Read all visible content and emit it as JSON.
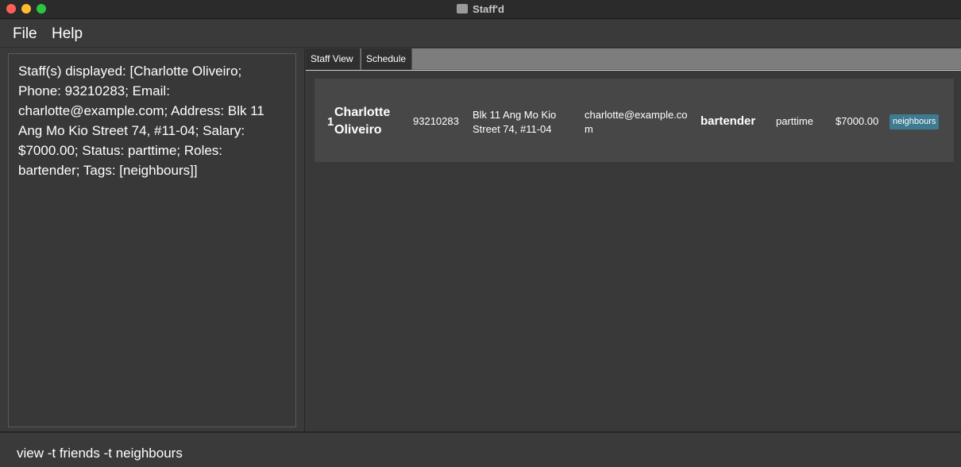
{
  "window": {
    "title": "Staff'd",
    "controls": [
      "close",
      "minimize",
      "maximize"
    ]
  },
  "menu": {
    "file": "File",
    "help": "Help"
  },
  "result_display": {
    "text": "Staff(s) displayed: [Charlotte Oliveiro; Phone: 93210283; Email: charlotte@example.com; Address: Blk 11 Ang Mo Kio Street 74, #11-04; Salary: $7000.00; Status: parttime; Roles: bartender; Tags: [neighbours]]"
  },
  "tabs": {
    "staff_view": "Staff View",
    "schedule": "Schedule"
  },
  "staff_list": [
    {
      "index": "1",
      "name": "Charlotte Oliveiro",
      "phone": "93210283",
      "address": "Blk 11 Ang Mo Kio Street 74, #11-04",
      "email": "charlotte@example.com",
      "role": "bartender",
      "status": "parttime",
      "salary": "$7000.00",
      "tag": "neighbours"
    }
  ],
  "command_box": {
    "value": "view -t friends -t neighbours"
  },
  "colors": {
    "tag": "#3e7b91",
    "background": "#3a3a3a",
    "card": "#474747"
  },
  "icons": [
    "app-icon"
  ]
}
